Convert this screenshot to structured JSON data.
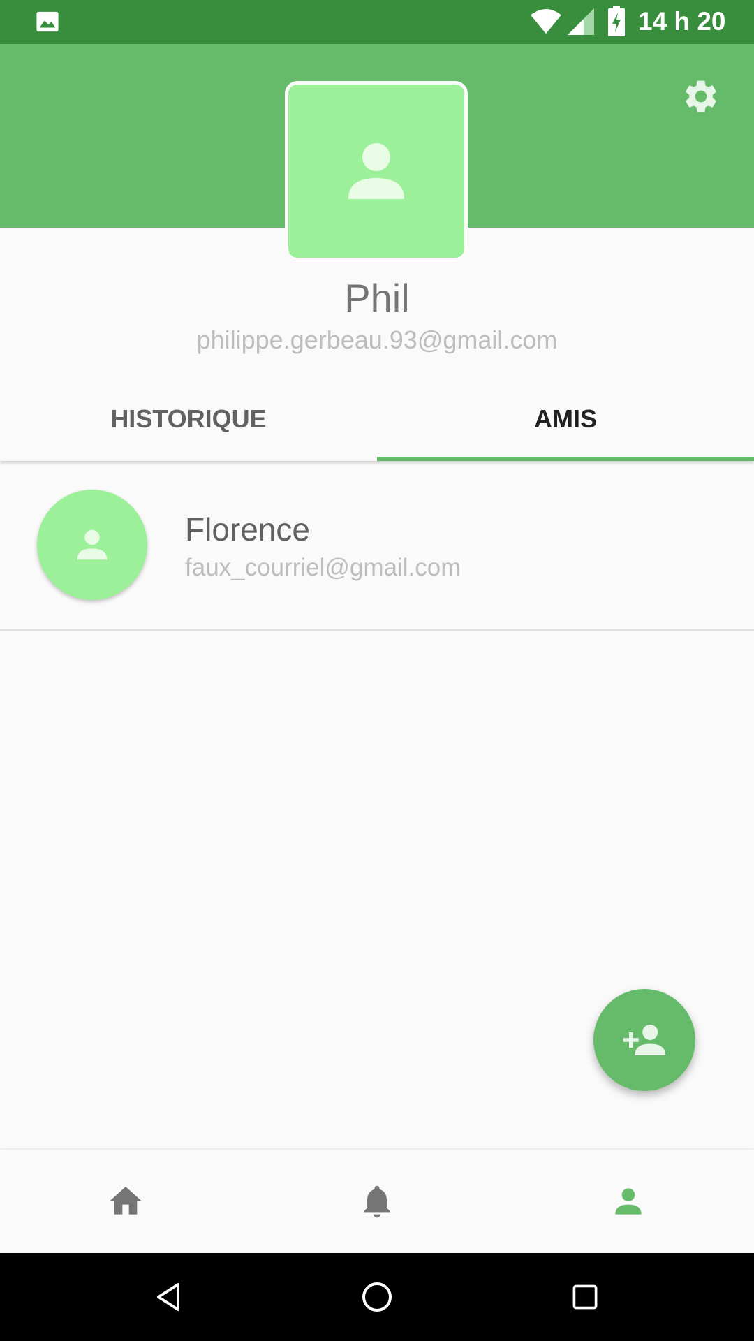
{
  "status_bar": {
    "time": "14 h 20",
    "icons": [
      "gallery-icon",
      "wifi-icon",
      "signal-icon",
      "battery-charging-icon"
    ]
  },
  "header": {
    "settings_icon": "gear-icon",
    "avatar_icon": "person-icon"
  },
  "profile": {
    "name": "Phil",
    "email": "philippe.gerbeau.93@gmail.com"
  },
  "tabs": [
    {
      "label": "HISTORIQUE",
      "selected": false
    },
    {
      "label": "AMIS",
      "selected": true
    }
  ],
  "friends": [
    {
      "name": "Florence",
      "email": "faux_courriel@gmail.com",
      "icon": "person-icon"
    }
  ],
  "fab": {
    "icon": "add-person-icon"
  },
  "bottom_nav": {
    "items": [
      {
        "icon": "home-icon",
        "active": false
      },
      {
        "icon": "bell-icon",
        "active": false
      },
      {
        "icon": "person-icon",
        "active": true
      }
    ]
  },
  "system_nav": {
    "items": [
      "back-icon",
      "home-circle-icon",
      "recents-icon"
    ]
  },
  "colors": {
    "status_bar": "#388e3c",
    "primary": "#66bb6a",
    "avatar_bg": "#9cf09a",
    "avatar_fg": "#e8fce6",
    "inactive_icon": "#757575"
  }
}
